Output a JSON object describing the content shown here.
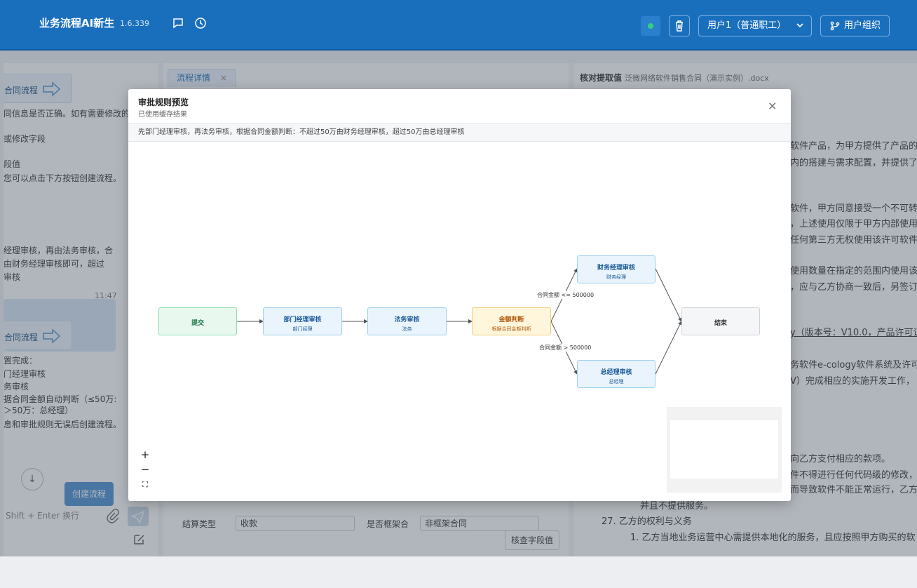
{
  "header": {
    "title": "业务流程AI新生",
    "version": "1.6.339",
    "user_select": "用户1（普通职工）",
    "org_button": "用户组织",
    "status_color": "#35d07f"
  },
  "chat": {
    "card1_label": "合同流程",
    "lines_a": [
      "同信息是否正确。如有需要修改的",
      "或修改字段",
      "段值",
      "您可以点击下方按钮创建流程。"
    ],
    "user_lines": [
      "经理审核，再由法务审核，合",
      "由财务经理审核即可，超过",
      "审核"
    ],
    "user_time": "11:47",
    "card2_label": "合同流程",
    "lines_b": [
      "置完成：",
      "门经理审核",
      "务审核",
      "据合同金额自动判断（≤50万:",
      "＞50万：总经理）",
      "息和审批规则无误后创建流程。"
    ],
    "create_button": "创建流程",
    "input_hint": "Shift + Enter 换行"
  },
  "middle": {
    "tab_label": "流程详情",
    "field1_label": "结算类型",
    "field1_value": "收款",
    "field2_label": "是否框架合",
    "field2_value": "非框架合同",
    "check_button": "核查字段值"
  },
  "right": {
    "title": "核对提取值",
    "file": "泛微网络软件销售合同（演示实例）.docx",
    "lines": [
      "软件产品，为甲方提供了产品的",
      "内的搭建与需求配置，并提供了",
      "软件，甲方同意接受一个不可转",
      "，上述使用仅限于甲方内部使用",
      "任何第三方无权使用该许可软件",
      "使用数量在指定的范围内使用该",
      "，应与乙方协商一致后，另签订",
      "y（版本号：V10.0，产品许可证",
      "务软件e-cology软件系统及许可",
      "V）完成相应的实施开发工作，",
      "向乙方支付相应的款项。",
      "件不得进行任何代码级的修改，",
      "而导致软件不能正常运行，乙方",
      "并且不提供服务。",
      "27. 乙方的权利与义务",
      "1. 乙方当地业务运营中心需提供本地化的服务，且应按照甲方购买的软"
    ]
  },
  "modal": {
    "title": "审批规则预览",
    "subtitle": "已使用缓存结果",
    "description": "先部门经理审核，再法务审核，根据合同金额判断：不超过50万由财务经理审核，超过50万由总经理审核",
    "close": "×",
    "nodes": [
      {
        "id": "submit",
        "label": "提交",
        "sub": ""
      },
      {
        "id": "dept",
        "label": "部门经理审核",
        "sub": "部门经理"
      },
      {
        "id": "legal",
        "label": "法务审核",
        "sub": "法务"
      },
      {
        "id": "amount",
        "label": "金额判断",
        "sub": "根据合同金额判断"
      },
      {
        "id": "finance",
        "label": "财务经理审核",
        "sub": "财务经理"
      },
      {
        "id": "gm",
        "label": "总经理审核",
        "sub": "总经理"
      },
      {
        "id": "end",
        "label": "结束",
        "sub": ""
      }
    ],
    "edge_labels": [
      "合同金额 <= 500000",
      "合同金额 > 500000"
    ],
    "zoom": [
      "+",
      "−",
      "⛶"
    ]
  },
  "colors": {
    "primary": "#1a6fbd",
    "submit_bg": "#e8f8ef",
    "task_bg": "#eaf4fc",
    "gateway_bg": "#fff6dc",
    "end_bg": "#f5f6f8"
  }
}
